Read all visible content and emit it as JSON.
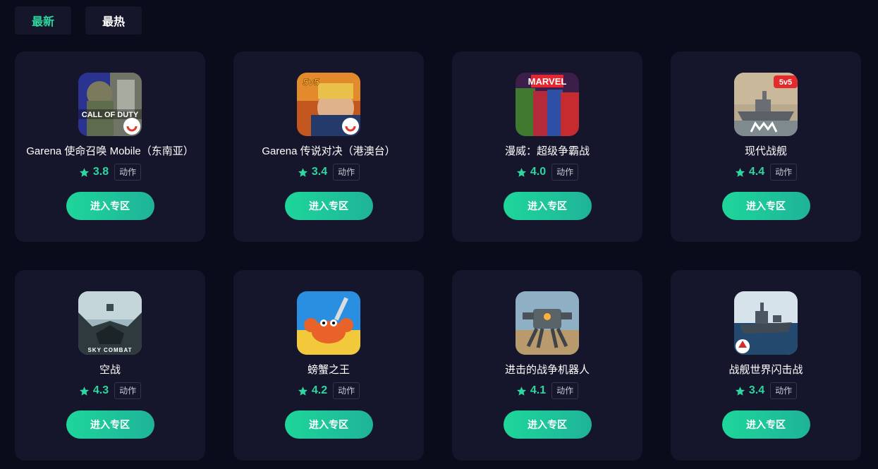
{
  "tabs": [
    {
      "label": "最新",
      "active": true
    },
    {
      "label": "最热",
      "active": false
    }
  ],
  "accent_color": "#2cd7a0",
  "games": [
    {
      "name": "Garena 使命召唤 Mobile（东南亚）",
      "rating": "3.8",
      "tag": "动作",
      "button": "进入专区",
      "icon": "call-of-duty-icon",
      "icon_text": "CALL OF DUTY"
    },
    {
      "name": "Garena 传说对决（港澳台）",
      "rating": "3.4",
      "tag": "动作",
      "button": "进入专区",
      "icon": "arena-of-valor-icon",
      "icon_text": "5v5"
    },
    {
      "name": "漫威：超级争霸战",
      "rating": "4.0",
      "tag": "动作",
      "button": "进入专区",
      "icon": "marvel-contest-icon",
      "icon_text": "MARVEL"
    },
    {
      "name": "现代战舰",
      "rating": "4.4",
      "tag": "动作",
      "button": "进入专区",
      "icon": "modern-warships-icon",
      "icon_text": "5v5"
    },
    {
      "name": "空战",
      "rating": "4.3",
      "tag": "动作",
      "button": "进入专区",
      "icon": "sky-combat-icon",
      "icon_text": "SKY COMBAT"
    },
    {
      "name": "螃蟹之王",
      "rating": "4.2",
      "tag": "动作",
      "button": "进入专区",
      "icon": "king-of-crabs-icon",
      "icon_text": ""
    },
    {
      "name": "进击的战争机器人",
      "rating": "4.1",
      "tag": "动作",
      "button": "进入专区",
      "icon": "war-robots-icon",
      "icon_text": ""
    },
    {
      "name": "战舰世界闪击战",
      "rating": "3.4",
      "tag": "动作",
      "button": "进入专区",
      "icon": "world-of-warships-blitz-icon",
      "icon_text": ""
    }
  ]
}
